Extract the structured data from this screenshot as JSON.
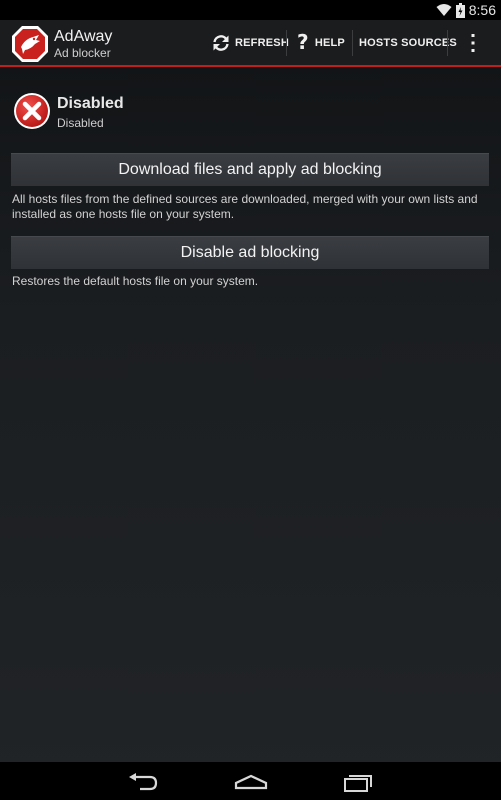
{
  "statusbar": {
    "time": "8:56",
    "wifi_icon": "wifi-icon",
    "battery_icon": "battery-icon"
  },
  "actionbar": {
    "title": "AdAway",
    "subtitle": "Ad blocker",
    "refresh_label": "REFRESH",
    "help_label": "HELP",
    "hosts_sources_label": "HOSTS SOURCES",
    "accent_color": "#c0201d"
  },
  "status": {
    "title": "Disabled",
    "subtitle": "Disabled",
    "icon": "error-x-icon"
  },
  "actions": {
    "download_label": "Download files and apply ad blocking",
    "download_description": "All hosts files from the defined sources are downloaded, merged with your own lists and installed as one hosts file on your system.",
    "disable_label": "Disable ad blocking",
    "disable_description": "Restores the default hosts file on your system."
  },
  "navbar": {
    "back_icon": "back-icon",
    "home_icon": "home-icon",
    "recent_icon": "recent-apps-icon"
  }
}
